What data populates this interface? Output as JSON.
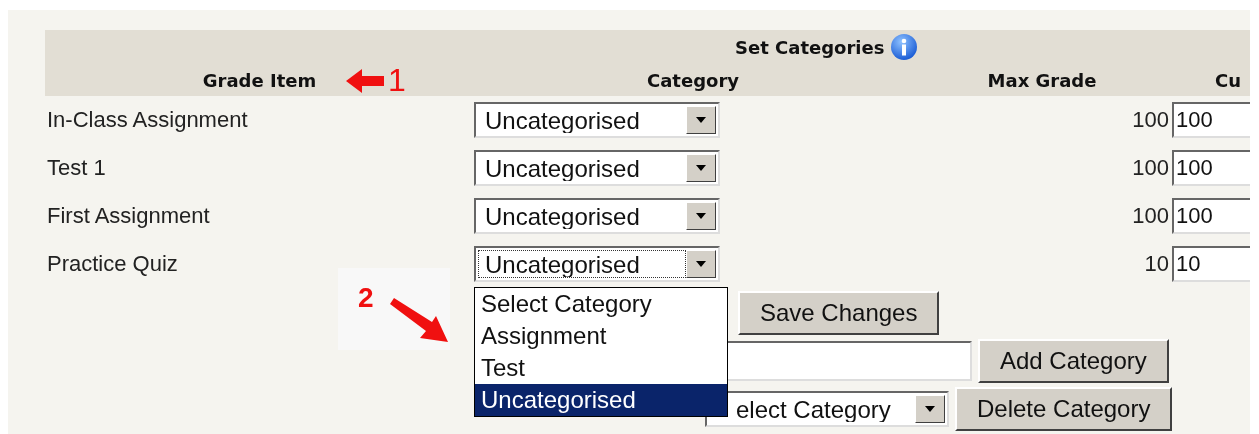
{
  "title": "Set Categories",
  "columns": [
    {
      "label": "Grade Item"
    },
    {
      "label": "Category"
    },
    {
      "label": "Max Grade"
    },
    {
      "label": "Cu"
    }
  ],
  "rows": [
    {
      "item": "In-Class Assignment",
      "category": "Uncategorised",
      "focused": false,
      "max_grade": "100",
      "current": "100"
    },
    {
      "item": "Test 1",
      "category": "Uncategorised",
      "focused": false,
      "max_grade": "100",
      "current": "100"
    },
    {
      "item": "First Assignment",
      "category": "Uncategorised",
      "focused": false,
      "max_grade": "100",
      "current": "100"
    },
    {
      "item": "Practice Quiz",
      "category": "Uncategorised",
      "focused": true,
      "max_grade": "10",
      "current": "10"
    }
  ],
  "save_button": "Save Changes",
  "add_button": "Add Category",
  "delete_select": "elect Category",
  "delete_button": "Delete Category",
  "dropdown_options": [
    {
      "label": "Select Category",
      "selected": false
    },
    {
      "label": "Assignment",
      "selected": false
    },
    {
      "label": "Test",
      "selected": false
    },
    {
      "label": "Uncategorised",
      "selected": true
    }
  ],
  "annotations": [
    {
      "label": "1",
      "kind": "left"
    },
    {
      "label": "2",
      "kind": "down-right"
    }
  ]
}
